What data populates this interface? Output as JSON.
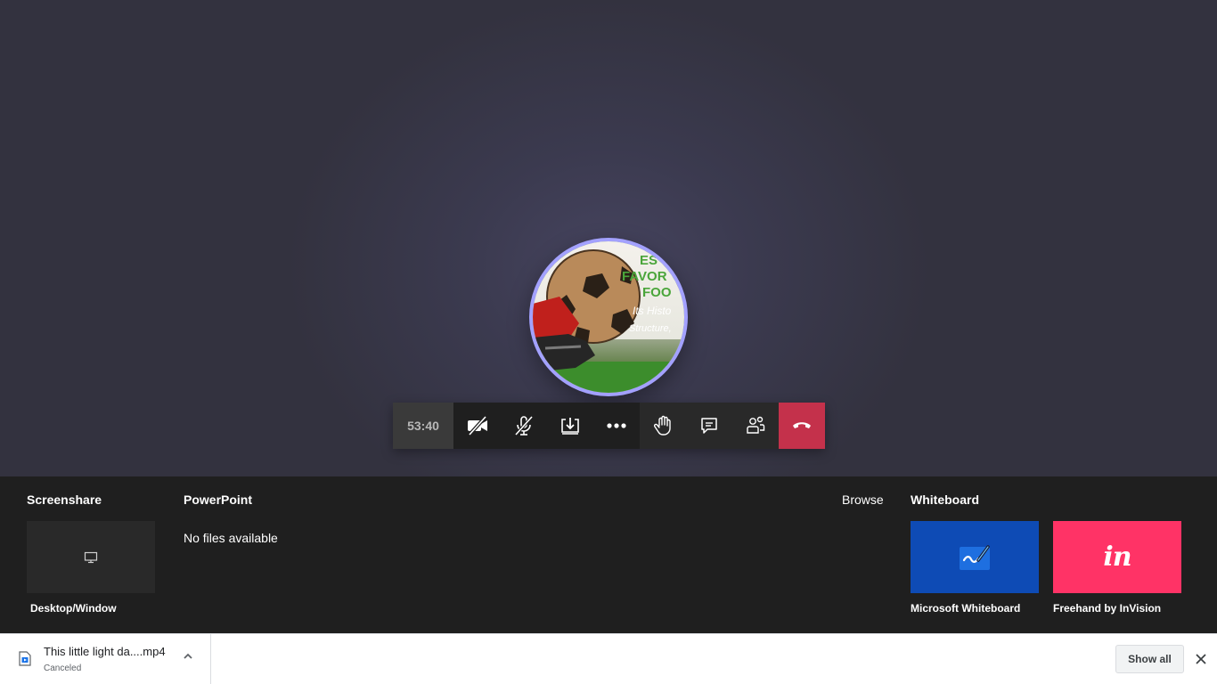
{
  "call": {
    "timer": "53:40",
    "avatar_text": [
      "ES",
      "FAVOR",
      "FOO",
      "Its Histo",
      "Structure,"
    ],
    "controls": [
      {
        "name": "camera-off",
        "label": "Turn camera on"
      },
      {
        "name": "mic-muted",
        "label": "Unmute"
      },
      {
        "name": "share",
        "label": "Share"
      },
      {
        "name": "more-actions",
        "label": "More actions"
      },
      {
        "name": "raise-hand",
        "label": "Raise your hand"
      },
      {
        "name": "chat",
        "label": "Show conversation"
      },
      {
        "name": "participants",
        "label": "Show participants"
      },
      {
        "name": "hang-up",
        "label": "Hang up"
      }
    ],
    "colors": {
      "ring": "#a3a1ff",
      "hangup": "#c4314b"
    }
  },
  "share_tray": {
    "screenshare": {
      "heading": "Screenshare",
      "tile_label": "Desktop/Window"
    },
    "powerpoint": {
      "heading": "PowerPoint",
      "empty_text": "No files available",
      "browse_label": "Browse"
    },
    "whiteboard": {
      "heading": "Whiteboard",
      "apps": [
        {
          "label": "Microsoft Whiteboard",
          "color": "#0e4bb5"
        },
        {
          "label": "Freehand by InVision",
          "logo_text": "in",
          "color": "#ff3366"
        }
      ]
    }
  },
  "download_bar": {
    "file_name": "This little light da....mp4",
    "status": "Canceled",
    "show_all_label": "Show all"
  }
}
